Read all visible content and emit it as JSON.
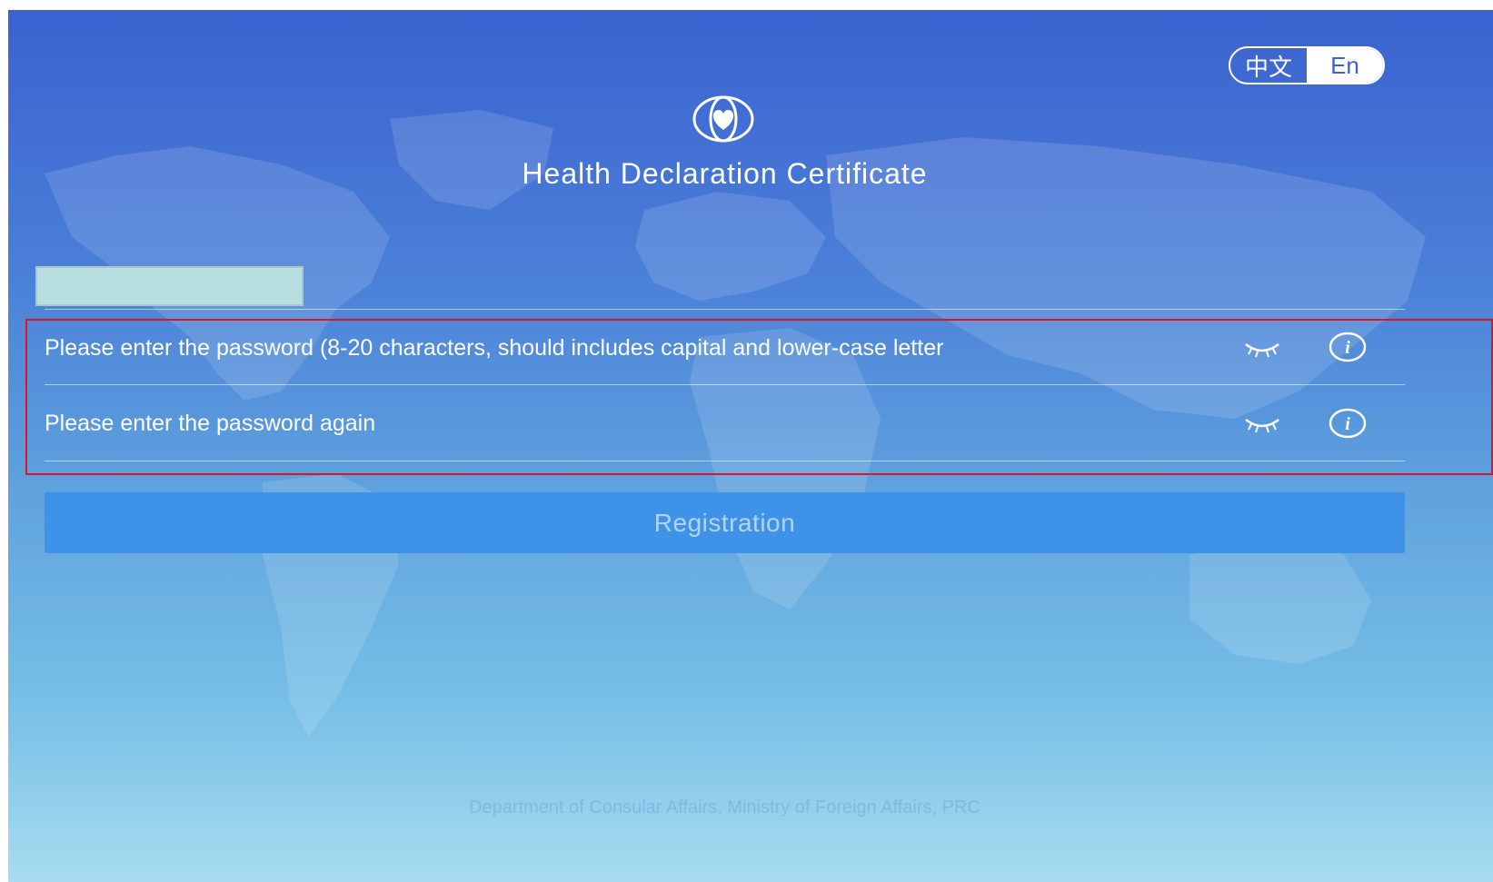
{
  "header": {
    "title": "Health Declaration Certificate",
    "logo_icon": "globe-heart-icon"
  },
  "language": {
    "options": [
      "中文",
      "En"
    ],
    "selected": "En"
  },
  "form": {
    "username_field": {
      "value": "",
      "state": "redacted"
    },
    "password": {
      "placeholder": "Please enter the password (8-20 characters, should includes capital and lower-case letter",
      "eye_icon": "eye-closed-icon",
      "info_icon": "info-icon"
    },
    "password_confirm": {
      "placeholder": "Please enter the password again",
      "eye_icon": "eye-closed-icon",
      "info_icon": "info-icon"
    },
    "submit_label": "Registration"
  },
  "footer": {
    "text": "Department of Consular Affairs, Ministry of Foreign Affairs, PRC"
  },
  "colors": {
    "background_top": "#3b62d0",
    "background_bottom": "#a8dcf0",
    "button": "#3e93e8",
    "highlight": "#e0141e"
  }
}
